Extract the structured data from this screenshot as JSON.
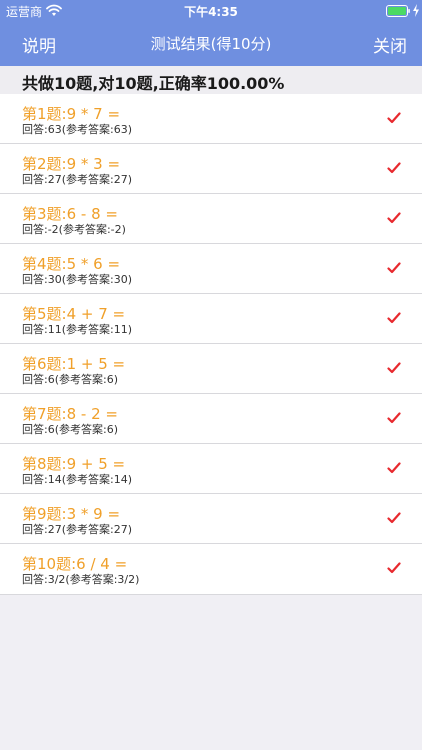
{
  "status_bar": {
    "carrier": "运营商",
    "time": "下午4:35"
  },
  "nav": {
    "left_label": "说明",
    "title": "测试结果(得10分)",
    "right_label": "关闭"
  },
  "summary": "共做10题,对10题,正确率100.00%",
  "questions": [
    {
      "question": "第1题:9 * 7 =",
      "answer": "回答:63(参考答案:63)",
      "correct": true
    },
    {
      "question": "第2题:9 * 3 =",
      "answer": "回答:27(参考答案:27)",
      "correct": true
    },
    {
      "question": "第3题:6 - 8 =",
      "answer": "回答:-2(参考答案:-2)",
      "correct": true
    },
    {
      "question": "第4题:5 * 6 =",
      "answer": "回答:30(参考答案:30)",
      "correct": true
    },
    {
      "question": "第5题:4 + 7 =",
      "answer": "回答:11(参考答案:11)",
      "correct": true
    },
    {
      "question": "第6题:1 + 5 =",
      "answer": "回答:6(参考答案:6)",
      "correct": true
    },
    {
      "question": "第7题:8 - 2 =",
      "answer": "回答:6(参考答案:6)",
      "correct": true
    },
    {
      "question": "第8题:9 + 5 =",
      "answer": "回答:14(参考答案:14)",
      "correct": true
    },
    {
      "question": "第9题:3 * 9 =",
      "answer": "回答:27(参考答案:27)",
      "correct": true
    },
    {
      "question": "第10题:6 / 4 =",
      "answer": "回答:3/2(参考答案:3/2)",
      "correct": true
    }
  ],
  "colors": {
    "nav_bg": "#6f8fe0",
    "question_text": "#f0a02a",
    "check_mark": "#e8292e"
  },
  "icons": {
    "status": [
      "wifi-icon",
      "battery-icon",
      "charging-icon"
    ],
    "row_mark": "check-icon"
  }
}
